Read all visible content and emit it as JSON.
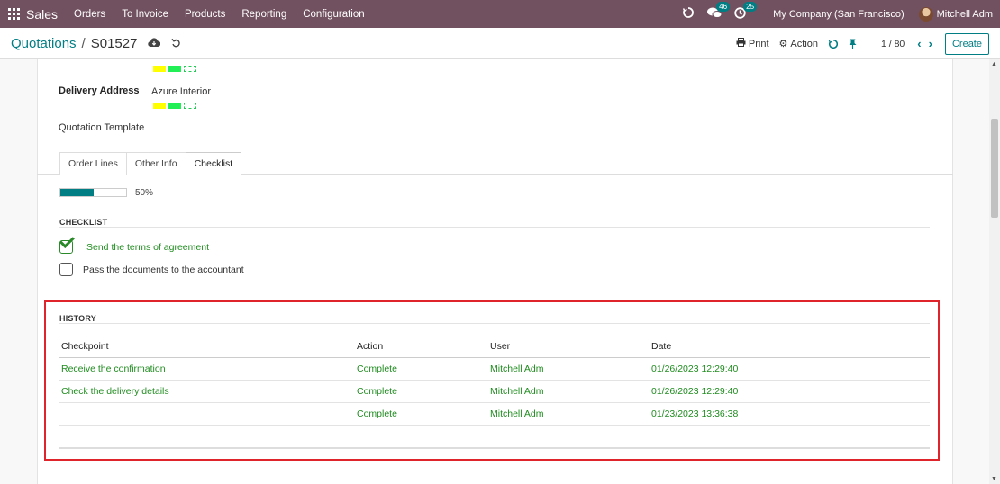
{
  "navbar": {
    "app": "Sales",
    "menu": [
      "Orders",
      "To Invoice",
      "Products",
      "Reporting",
      "Configuration"
    ],
    "messages_count": "46",
    "activities_count": "25",
    "company": "My Company (San Francisco)",
    "user": "Mitchell Adm"
  },
  "control": {
    "breadcrumb_parent": "Quotations",
    "breadcrumb_separator": "/",
    "record": "S01527",
    "print_label": "Print",
    "action_label": "Action",
    "pager": "1 / 80",
    "create_label": "Create"
  },
  "form": {
    "delivery_address_label": "Delivery Address",
    "delivery_address_value": "Azure Interior",
    "quotation_template_label": "Quotation Template"
  },
  "tabs": [
    {
      "label": "Order Lines"
    },
    {
      "label": "Other Info"
    },
    {
      "label": "Checklist"
    }
  ],
  "progress": {
    "value": 0.5,
    "label": "50%"
  },
  "checklist": {
    "title": "CHECKLIST",
    "items": [
      {
        "label": "Send the terms of agreement",
        "checked": true
      },
      {
        "label": "Pass the documents to the accountant",
        "checked": false
      }
    ]
  },
  "history": {
    "title": "HISTORY",
    "columns": [
      "Checkpoint",
      "Action",
      "User",
      "Date"
    ],
    "rows": [
      {
        "checkpoint": "Receive the confirmation",
        "action": "Complete",
        "user": "Mitchell Adm",
        "date": "01/26/2023 12:29:40"
      },
      {
        "checkpoint": "Check the delivery details",
        "action": "Complete",
        "user": "Mitchell Adm",
        "date": "01/26/2023 12:29:40"
      },
      {
        "checkpoint": "",
        "action": "Complete",
        "user": "Mitchell Adm",
        "date": "01/23/2023 13:36:38"
      }
    ]
  },
  "colors": {
    "navbar": "#71505f",
    "accent": "#017e84",
    "done_text": "#1f8c1f",
    "highlight": "#e0242b"
  }
}
